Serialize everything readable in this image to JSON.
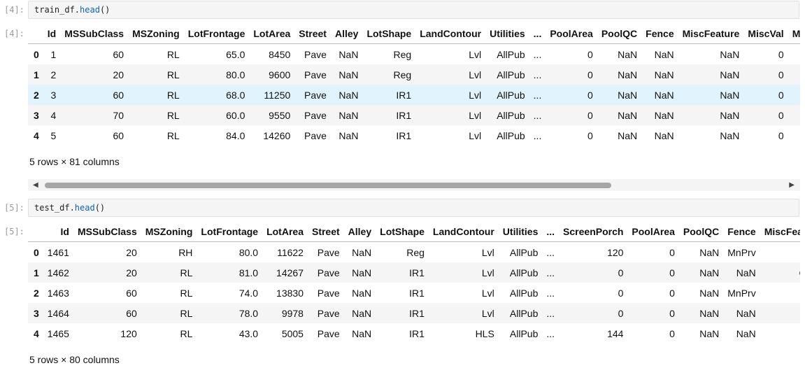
{
  "cell1": {
    "in_prompt": "[4]:",
    "out_prompt": "[4]:",
    "code_obj": "train_df.",
    "code_fn": "head",
    "code_paren": "()",
    "columns": [
      "Id",
      "MSSubClass",
      "MSZoning",
      "LotFrontage",
      "LotArea",
      "Street",
      "Alley",
      "LotShape",
      "LandContour",
      "Utilities",
      "...",
      "PoolArea",
      "PoolQC",
      "Fence",
      "MiscFeature",
      "MiscVal",
      "Mo"
    ],
    "rows": [
      [
        "0",
        "1",
        "60",
        "RL",
        "65.0",
        "8450",
        "Pave",
        "NaN",
        "Reg",
        "Lvl",
        "AllPub",
        "...",
        "0",
        "NaN",
        "NaN",
        "NaN",
        "0",
        ""
      ],
      [
        "1",
        "2",
        "20",
        "RL",
        "80.0",
        "9600",
        "Pave",
        "NaN",
        "Reg",
        "Lvl",
        "AllPub",
        "...",
        "0",
        "NaN",
        "NaN",
        "NaN",
        "0",
        ""
      ],
      [
        "2",
        "3",
        "60",
        "RL",
        "68.0",
        "11250",
        "Pave",
        "NaN",
        "IR1",
        "Lvl",
        "AllPub",
        "...",
        "0",
        "NaN",
        "NaN",
        "NaN",
        "0",
        ""
      ],
      [
        "3",
        "4",
        "70",
        "RL",
        "60.0",
        "9550",
        "Pave",
        "NaN",
        "IR1",
        "Lvl",
        "AllPub",
        "...",
        "0",
        "NaN",
        "NaN",
        "NaN",
        "0",
        ""
      ],
      [
        "4",
        "5",
        "60",
        "RL",
        "84.0",
        "14260",
        "Pave",
        "NaN",
        "IR1",
        "Lvl",
        "AllPub",
        "...",
        "0",
        "NaN",
        "NaN",
        "NaN",
        "0",
        ""
      ]
    ],
    "footer": "5 rows × 81 columns"
  },
  "scrollbar": {
    "left_arrow": "◀",
    "right_arrow": "▶"
  },
  "cell2": {
    "in_prompt": "[5]:",
    "out_prompt": "[5]:",
    "code_obj": "test_df.",
    "code_fn": "head",
    "code_paren": "()",
    "columns": [
      "Id",
      "MSSubClass",
      "MSZoning",
      "LotFrontage",
      "LotArea",
      "Street",
      "Alley",
      "LotShape",
      "LandContour",
      "Utilities",
      "...",
      "ScreenPorch",
      "PoolArea",
      "PoolQC",
      "Fence",
      "MiscFeatu"
    ],
    "rows": [
      [
        "0",
        "1461",
        "20",
        "RH",
        "80.0",
        "11622",
        "Pave",
        "NaN",
        "Reg",
        "Lvl",
        "AllPub",
        "...",
        "120",
        "0",
        "NaN",
        "MnPrv",
        "Na"
      ],
      [
        "1",
        "1462",
        "20",
        "RL",
        "81.0",
        "14267",
        "Pave",
        "NaN",
        "IR1",
        "Lvl",
        "AllPub",
        "...",
        "0",
        "0",
        "NaN",
        "NaN",
        "Ga"
      ],
      [
        "2",
        "1463",
        "60",
        "RL",
        "74.0",
        "13830",
        "Pave",
        "NaN",
        "IR1",
        "Lvl",
        "AllPub",
        "...",
        "0",
        "0",
        "NaN",
        "MnPrv",
        "Na"
      ],
      [
        "3",
        "1464",
        "60",
        "RL",
        "78.0",
        "9978",
        "Pave",
        "NaN",
        "IR1",
        "Lvl",
        "AllPub",
        "...",
        "0",
        "0",
        "NaN",
        "NaN",
        "Na"
      ],
      [
        "4",
        "1465",
        "120",
        "RL",
        "43.0",
        "5005",
        "Pave",
        "NaN",
        "IR1",
        "HLS",
        "AllPub",
        "...",
        "144",
        "0",
        "NaN",
        "NaN",
        "Na"
      ]
    ],
    "footer": "5 rows × 80 columns"
  }
}
